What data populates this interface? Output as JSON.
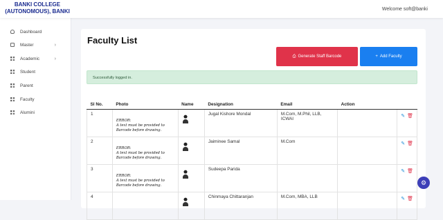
{
  "header": {
    "brand_line1": "BANKI COLLEGE",
    "brand_line2": "(AUTONOMOUS), BANKI",
    "welcome": "Welcome soft@banki"
  },
  "sidebar": {
    "items": [
      {
        "label": "Dashboard",
        "icon": "user-icon"
      },
      {
        "label": "Master",
        "icon": "card-icon",
        "chevron": "›"
      },
      {
        "label": "Academic",
        "icon": "grid-icon",
        "chevron": "›"
      },
      {
        "label": "Student",
        "icon": "grid-icon"
      },
      {
        "label": "Parent",
        "icon": "grid-icon"
      },
      {
        "label": "Faculty",
        "icon": "grid-icon"
      },
      {
        "label": "Alumini",
        "icon": "grid-icon"
      }
    ]
  },
  "main": {
    "title": "Faculty List",
    "btn_barcode": "Generate Staff Barcode",
    "btn_add": "Add Faculty",
    "alert": "Successfully logged in.",
    "columns": [
      "Sl No.",
      "Photo",
      "Name",
      "Designation",
      "Email",
      "Action"
    ],
    "photo_error_line1": "ERROR:",
    "photo_error_line2": "A text must be provided to Barcode before drawing.",
    "rows": [
      {
        "sl": "1",
        "designation": "Jugal Kishore Mondal",
        "email": "M.Com, M.Phil, LLB, ICWAI"
      },
      {
        "sl": "2",
        "designation": "Jaiminee Samal",
        "email": "M.Com"
      },
      {
        "sl": "3",
        "designation": "Sudeepa Parida",
        "email": ""
      },
      {
        "sl": "4",
        "designation": "Chinmaya Chittaranjan",
        "email": "M.Com, MBA, LLB"
      }
    ]
  },
  "colors": {
    "primary": "#1a7ff0",
    "danger": "#e0334a",
    "brand": "#1a2b8f",
    "success_bg": "#d5eedd"
  }
}
